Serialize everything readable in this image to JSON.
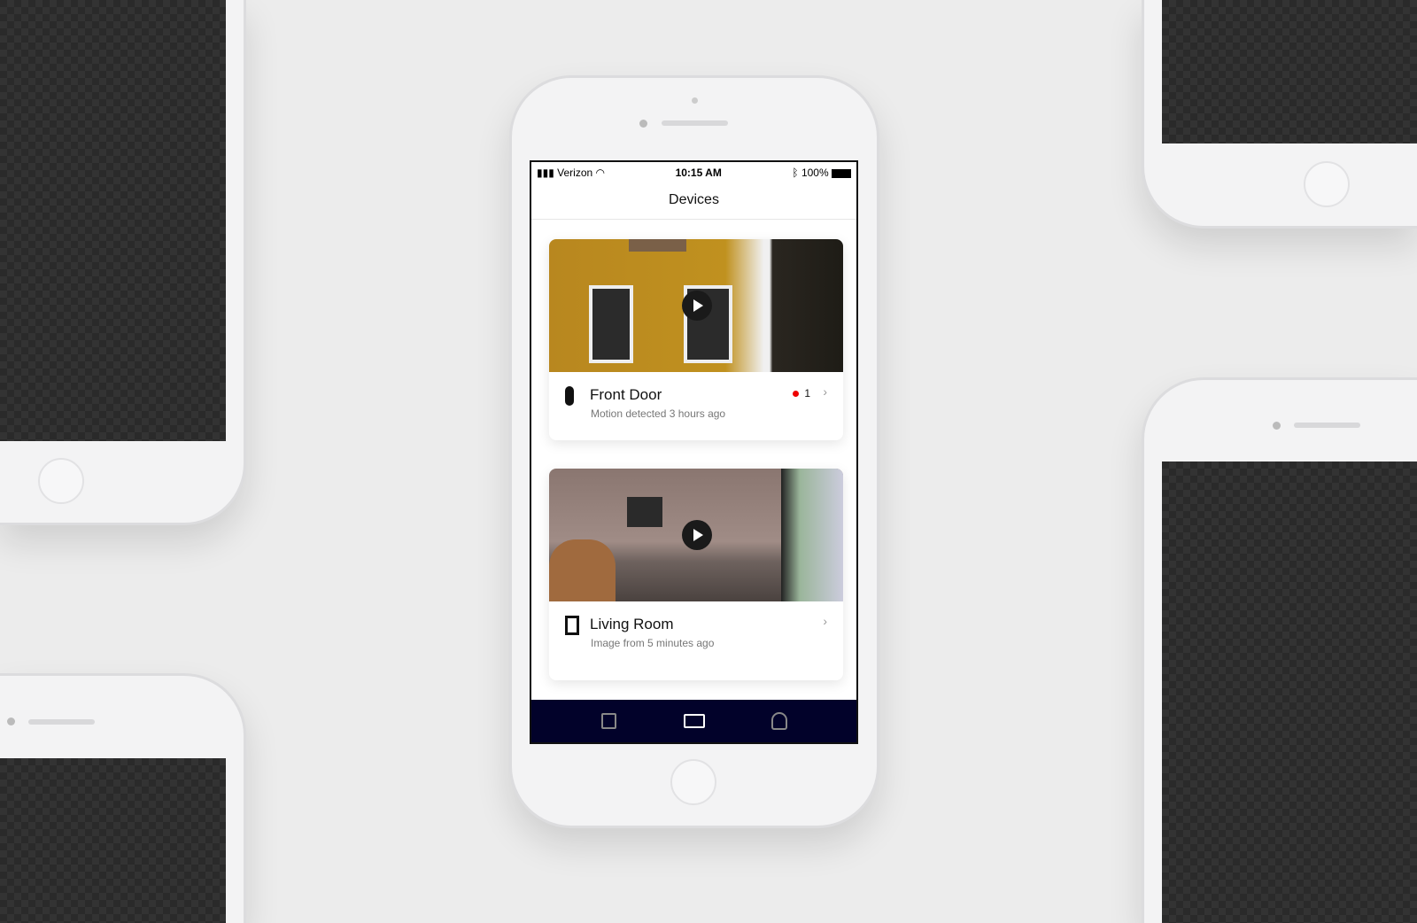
{
  "status_bar": {
    "carrier": "Verizon",
    "time": "10:15 AM",
    "battery": "100%"
  },
  "header": {
    "title": "Devices"
  },
  "devices": [
    {
      "name": "Front Door",
      "subtitle": "Motion detected 3 hours ago",
      "badge_count": "1",
      "icon": "doorbell-icon"
    },
    {
      "name": "Living Room",
      "subtitle": "Image from 5 minutes ago",
      "icon": "window-camera-icon"
    }
  ],
  "tabs": [
    {
      "icon": "calendar-icon"
    },
    {
      "icon": "video-camera-icon",
      "active": true
    },
    {
      "icon": "user-icon"
    }
  ],
  "colors": {
    "tabbar": "#02022a",
    "badge_dot": "#e00000"
  }
}
